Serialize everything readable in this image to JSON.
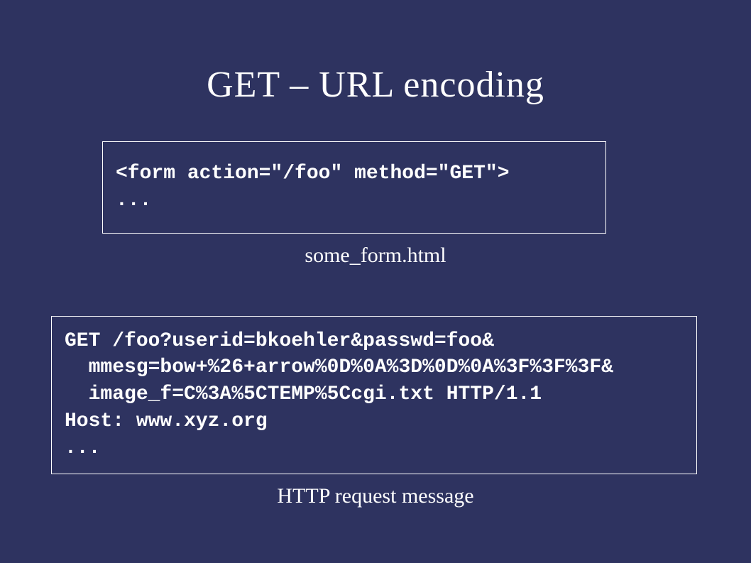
{
  "title": "GET – URL encoding",
  "code1": "<form action=\"/foo\" method=\"GET\">\n...",
  "caption1": "some_form.html",
  "code2": "GET /foo?userid=bkoehler&passwd=foo&\n  mmesg=bow+%26+arrow%0D%0A%3D%0D%0A%3F%3F%3F&\n  image_f=C%3A%5CTEMP%5Ccgi.txt HTTP/1.1\nHost: www.xyz.org\n...",
  "caption2": "HTTP request message"
}
